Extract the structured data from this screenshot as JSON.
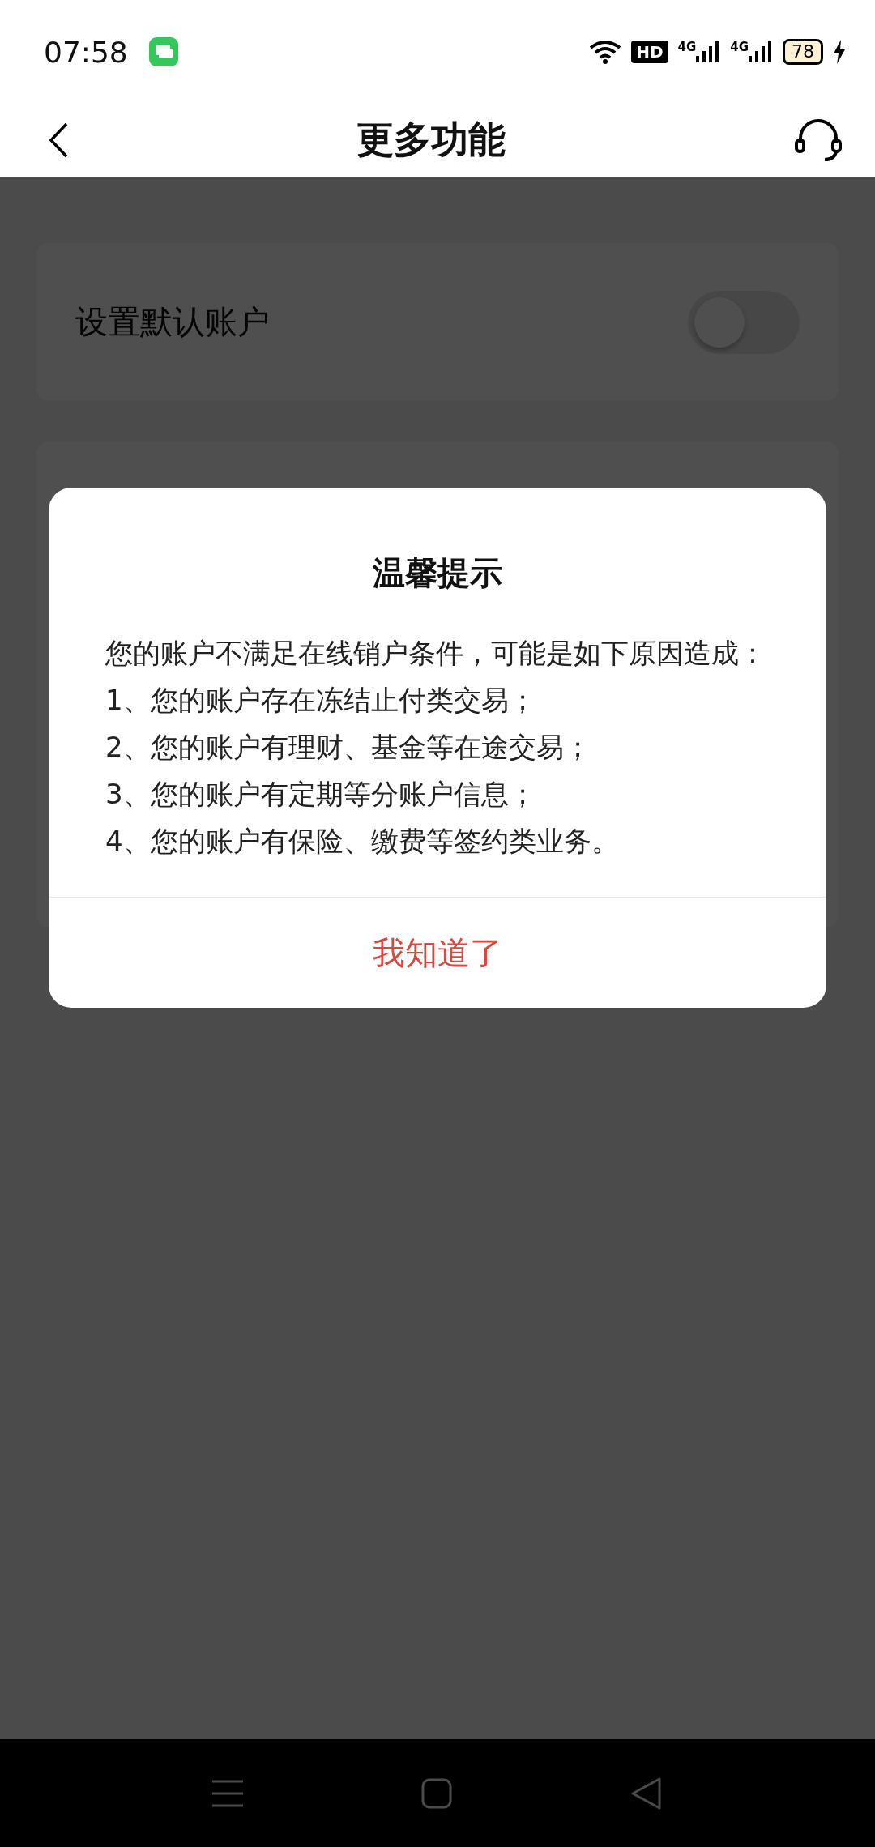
{
  "status_bar": {
    "time": "07:58",
    "hd": "HD",
    "networks": [
      "4G",
      "4G"
    ],
    "battery": "78"
  },
  "header": {
    "title": "更多功能"
  },
  "settings": [
    {
      "label": "设置默认账户",
      "on": false
    }
  ],
  "dialog": {
    "title": "温馨提示",
    "lines": [
      "您的账户不满足在线销户条件，可能是如下原因造成：",
      "1、您的账户存在冻结止付类交易；",
      "2、您的账户有理财、基金等在途交易；",
      "3、您的账户有定期等分账户信息；",
      "4、您的账户有保险、缴费等签约类业务。"
    ],
    "button": "我知道了"
  }
}
